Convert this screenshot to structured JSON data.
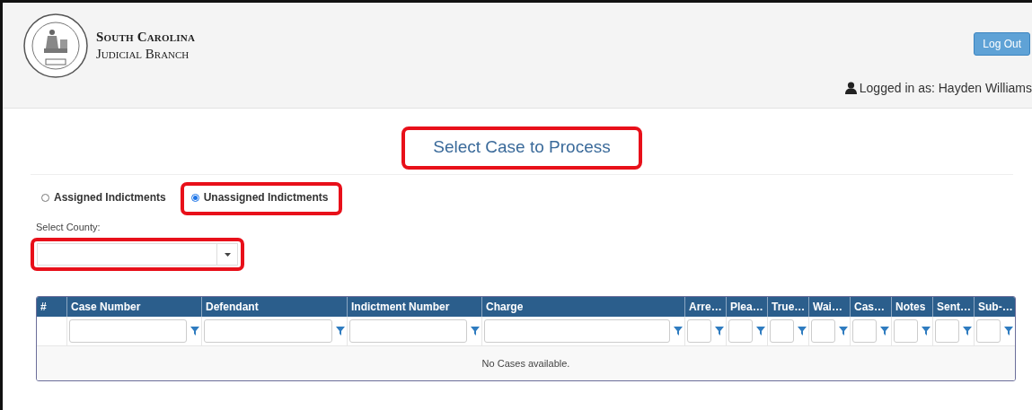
{
  "header": {
    "org_line_1": "South Carolina",
    "org_line_2": "Judicial Branch",
    "logout_button": "Log Out",
    "logged_in": "Logged in as: Hayden Williams"
  },
  "title": {
    "text": "Select Case to Process",
    "highlighted": true
  },
  "radios": [
    {
      "label": "Assigned Indictments",
      "selected": false,
      "highlighted": false
    },
    {
      "label": "Unassigned Indictments",
      "selected": true,
      "highlighted": true
    }
  ],
  "county": {
    "label": "Select County:",
    "highlighted": true
  },
  "table": {
    "columns": [
      {
        "label": "#",
        "filter": false
      },
      {
        "label": "Case Number",
        "filter": true
      },
      {
        "label": "Defendant",
        "filter": true
      },
      {
        "label": "Indictment Number",
        "filter": true
      },
      {
        "label": "Charge",
        "filter": true
      },
      {
        "label": "Arre…",
        "filter": true
      },
      {
        "label": "Plea…",
        "filter": true
      },
      {
        "label": "True…",
        "filter": true
      },
      {
        "label": "Wai…",
        "filter": true
      },
      {
        "label": "Cas…",
        "filter": true
      },
      {
        "label": "Notes",
        "filter": true
      },
      {
        "label": "Sent…",
        "filter": true
      },
      {
        "label": "Sub-…",
        "filter": true
      }
    ],
    "empty_message": "No Cases available."
  }
}
